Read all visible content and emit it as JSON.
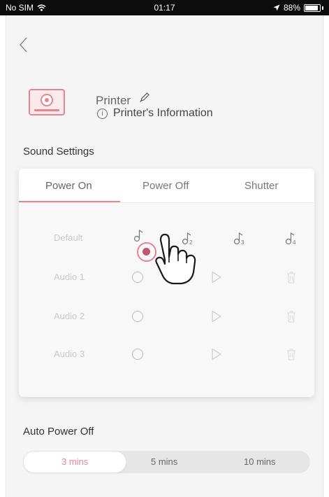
{
  "status_bar": {
    "carrier": "No SIM",
    "time": "01:17",
    "battery": "88%",
    "battery_level": 0.88
  },
  "printer": {
    "name": "Printer",
    "info_label": "Printer's Information"
  },
  "sound_settings": {
    "title": "Sound Settings",
    "tabs": [
      "Power On",
      "Power Off",
      "Shutter"
    ],
    "active_tab": "Power On",
    "rows": [
      "Default",
      "Audio 1",
      "Audio 2",
      "Audio 3"
    ],
    "note_numbers": [
      "",
      "2",
      "3",
      "4"
    ],
    "selected_option": "Default 1"
  },
  "auto_power_off": {
    "title": "Auto Power Off",
    "options": [
      "3 mins",
      "5 mins",
      "10 mins"
    ],
    "selected": "3 mins"
  },
  "colors": {
    "accent": "#e8848f",
    "background": "#f5f5f5"
  }
}
